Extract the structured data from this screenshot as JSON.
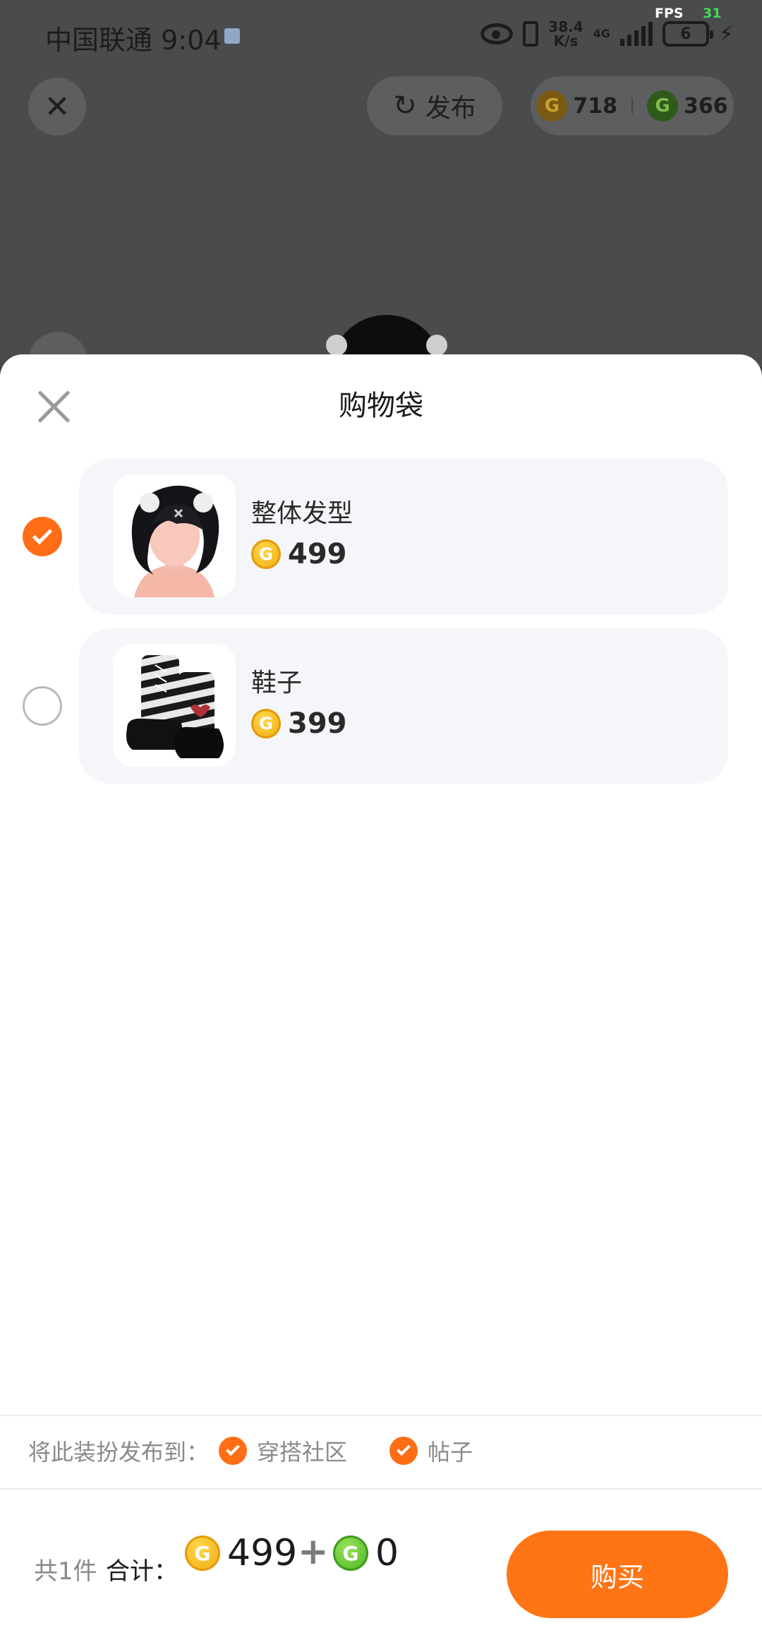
{
  "status_bar": {
    "carrier": "中国联通",
    "time": "9:04",
    "net_speed_value": "38.4",
    "net_speed_unit": "K/s",
    "network_type": "4G",
    "battery_level": "6",
    "fps_label": "FPS",
    "fps_value": "31"
  },
  "header": {
    "publish_label": "发布",
    "gold_balance": "718",
    "green_balance": "366"
  },
  "sheet": {
    "title": "购物袋",
    "items": [
      {
        "name": "整体发型",
        "price": "499",
        "checked": true,
        "thumb_icon": "hairstyle-thumbnail"
      },
      {
        "name": "鞋子",
        "price": "399",
        "checked": false,
        "thumb_icon": "boots-thumbnail"
      }
    ],
    "publish_to_label": "将此装扮发布到：",
    "publish_options": [
      {
        "label": "穿搭社区",
        "checked": true
      },
      {
        "label": "帖子",
        "checked": true
      }
    ]
  },
  "footer": {
    "count_label": "共1件",
    "total_label": "合计：",
    "gold_total": "499",
    "plus": "+",
    "green_total": "0",
    "buy_label": "购买"
  },
  "colors": {
    "accent": "#ff7414",
    "check": "#ff6d15",
    "gold_coin": "#f1a812",
    "green_coin": "#45b222"
  }
}
